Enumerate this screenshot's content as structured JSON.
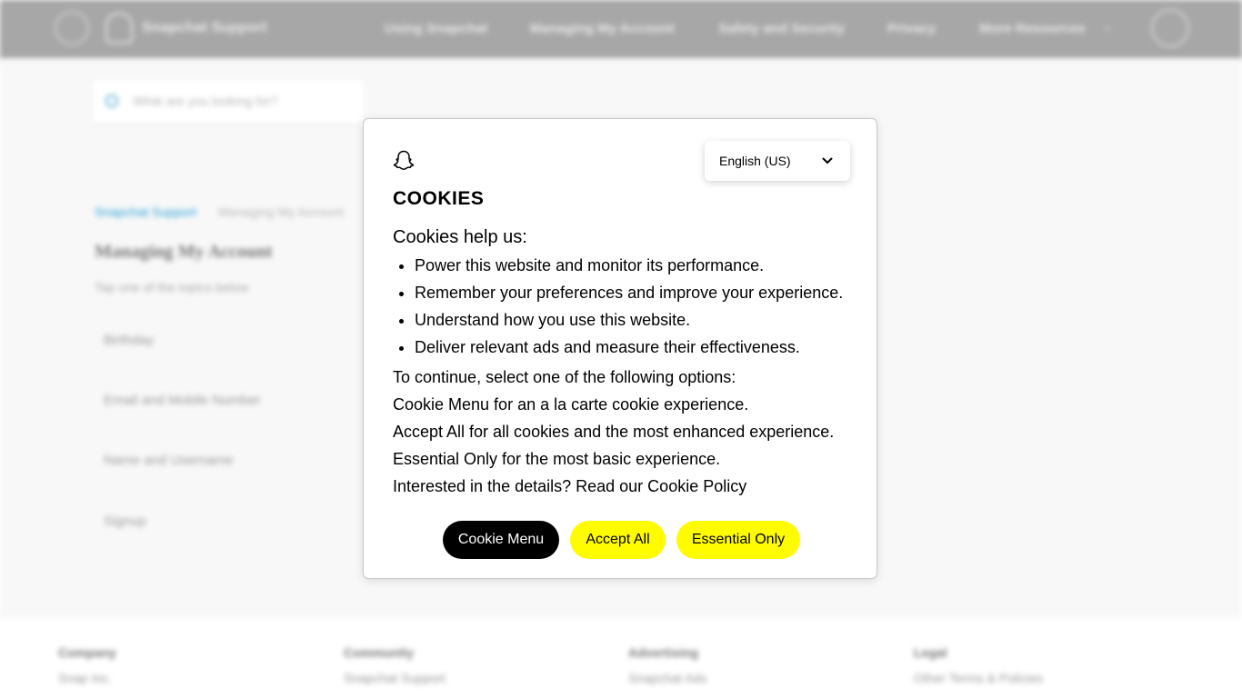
{
  "background": {
    "header": {
      "brand": "Snapchat Support",
      "nav": [
        "Using Snapchat",
        "Managing My Account",
        "Safety and Security",
        "Privacy",
        "More Resources"
      ]
    },
    "search": {
      "placeholder": "What are you looking for?"
    },
    "breadcrumb": [
      "Snapchat Support",
      "Managing My Account"
    ],
    "heading": "Managing My Account",
    "subheading": "Tap one of the topics below",
    "topics": [
      "Birthday",
      "Email and Mobile Number",
      "Name and Username",
      "Signup"
    ],
    "footer": {
      "columns": [
        {
          "head": "Company",
          "link": "Snap Inc."
        },
        {
          "head": "Community",
          "link": "Snapchat Support"
        },
        {
          "head": "Advertising",
          "link": "Snapchat Ads"
        },
        {
          "head": "Legal",
          "link": "Other Terms & Policies"
        }
      ]
    }
  },
  "cookie_modal": {
    "language": "English (US)",
    "title": "COOKIES",
    "intro": "Cookies help us:",
    "bullets": [
      "Power this website and monitor its performance.",
      "Remember your preferences and improve your experience.",
      "Understand how you use this website.",
      "Deliver relevant ads and measure their effectiveness."
    ],
    "paragraphs": [
      "To continue, select one of the following options:",
      "Cookie Menu for an a la carte cookie experience.",
      "Accept All for all cookies and the most enhanced experience.",
      "Essential Only for the most basic experience.",
      "Interested in the details? Read our Cookie Policy"
    ],
    "buttons": {
      "menu": "Cookie Menu",
      "accept": "Accept All",
      "essential": "Essential Only"
    }
  },
  "colors": {
    "accent_yellow": "#fffc00",
    "primary_black": "#000000",
    "header_gray": "#a7a7a7",
    "link_blue": "#2aa1d8"
  },
  "icons": {
    "logo": "snapchat-ghost-icon",
    "language_chevron": "chevron-down-icon"
  }
}
